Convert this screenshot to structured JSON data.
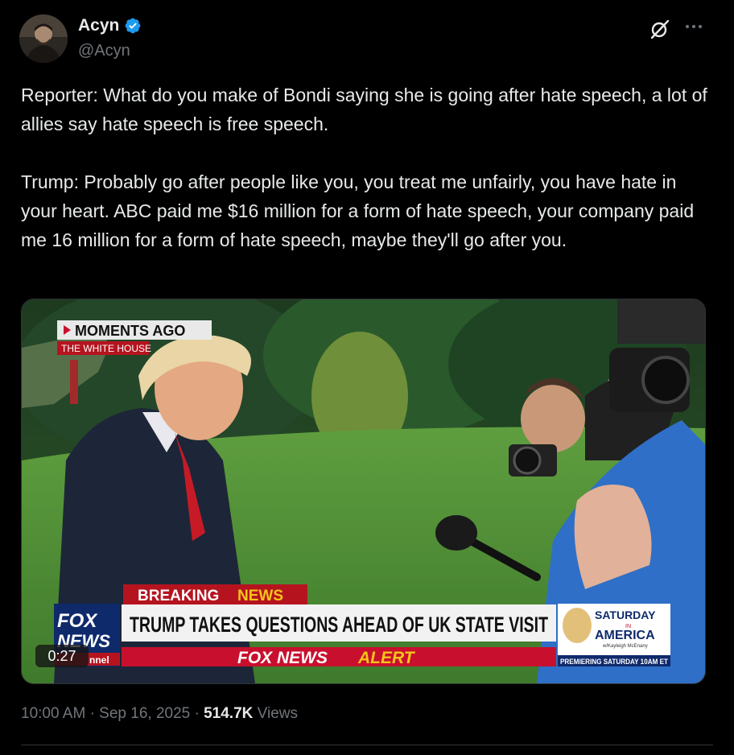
{
  "author": {
    "name": "Acyn",
    "handle": "@Acyn",
    "verified": true,
    "avatar_icon": "avatar-icon"
  },
  "icons": {
    "verified": "verified-badge-icon",
    "grok": "grok-icon",
    "more": "more-icon"
  },
  "colors": {
    "background": "#000000",
    "text": "#e7e9ea",
    "muted": "#71767b",
    "verified": "#1d9bf0",
    "fox_red": "#c8102e",
    "fox_blue": "#0f2a6b"
  },
  "tweet": {
    "text": "Reporter: What do you make of Bondi saying she is going after hate speech, a lot of allies say hate speech is free speech.\n\nTrump: Probably go after people like you, you treat me unfairly, you have hate in your heart. ABC paid me $16 million for a form of hate speech, your company paid me 16 million for a form of hate speech, maybe they'll go after you."
  },
  "video": {
    "duration": "0:27",
    "overlay": {
      "moments_ago": "MOMENTS AGO",
      "location": "THE WHITE HOUSE",
      "breaking": "BREAKING",
      "news": "NEWS",
      "headline": "TRUMP TAKES QUESTIONS AHEAD OF UK STATE VISIT",
      "alert_fox": "FOX NEWS",
      "alert_word": "ALERT",
      "logo_fox": "FOX",
      "logo_news": "NEWS",
      "logo_channel": "nnel",
      "promo_title_1": "SATURDAY",
      "promo_in": "IN",
      "promo_title_2": "AMERICA",
      "promo_host": "w/Kayleigh McEnany",
      "promo_time": "PREMIERING SATURDAY 10AM ET"
    }
  },
  "meta": {
    "time": "10:00 AM",
    "date": "Sep 16, 2025",
    "views_count": "514.7K",
    "views_label": "Views"
  }
}
